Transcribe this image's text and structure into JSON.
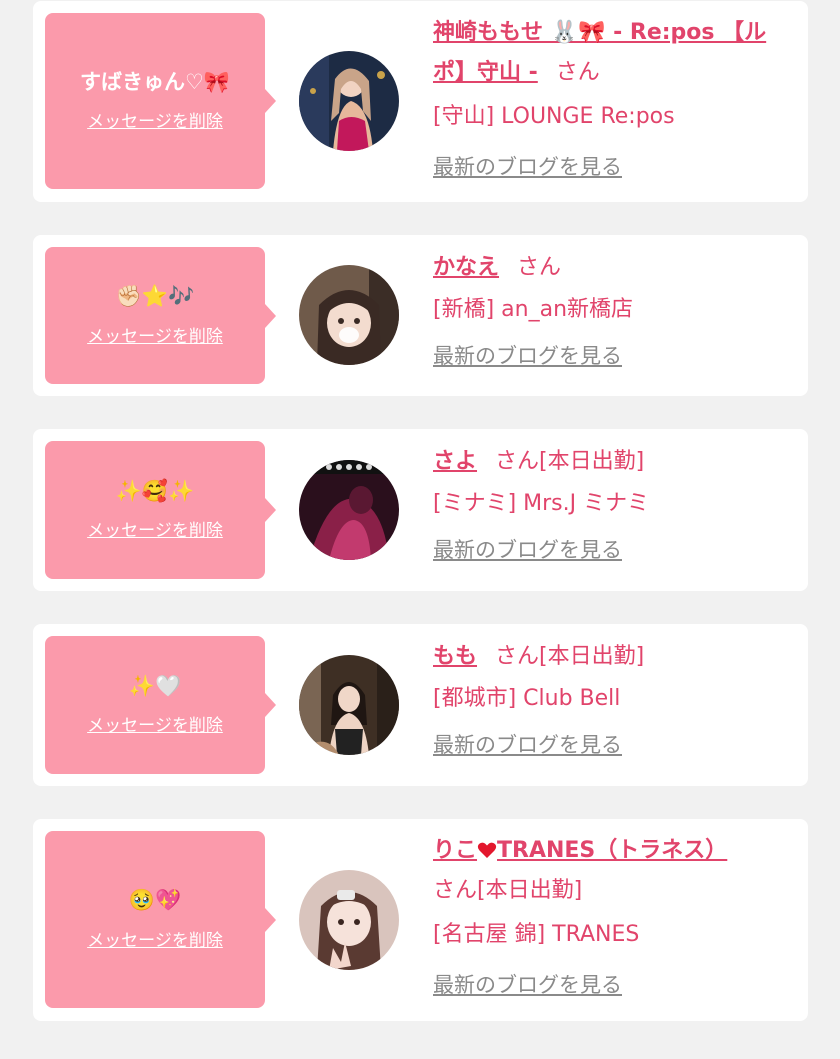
{
  "delete_label": "メッセージを削除",
  "blog_label": "最新のブログを見る",
  "san_suffix": "さん",
  "colors": {
    "background": "#f1f1f1",
    "bubble": "#fb9aab",
    "accent": "#e1446b",
    "link_gray": "#8a8a8a"
  },
  "cards": [
    {
      "message": "すばきゅん♡🎀",
      "name": "神崎ももせ 🐰🎀 - Re:pos 【ルポ】守山 -",
      "san": "さん",
      "shop": "[守山] LOUNGE Re:pos"
    },
    {
      "message": "✊🏻⭐🎶",
      "name": "かなえ",
      "san": "さん",
      "shop": "[新橋] an_an新橋店"
    },
    {
      "message": "✨🥰✨",
      "name": "さよ",
      "san": "さん[本日出勤]",
      "shop": "[ミナミ] Mrs.J ミナミ"
    },
    {
      "message": "✨🤍",
      "name": "もも",
      "san": "さん[本日出勤]",
      "shop": "[都城市] Club Bell"
    },
    {
      "message": "🥹💖",
      "name_before": "りこ",
      "name_after": "TRANES（トラネス）",
      "san": "さん[本日出勤]",
      "shop": "[名古屋 錦] TRANES"
    }
  ]
}
